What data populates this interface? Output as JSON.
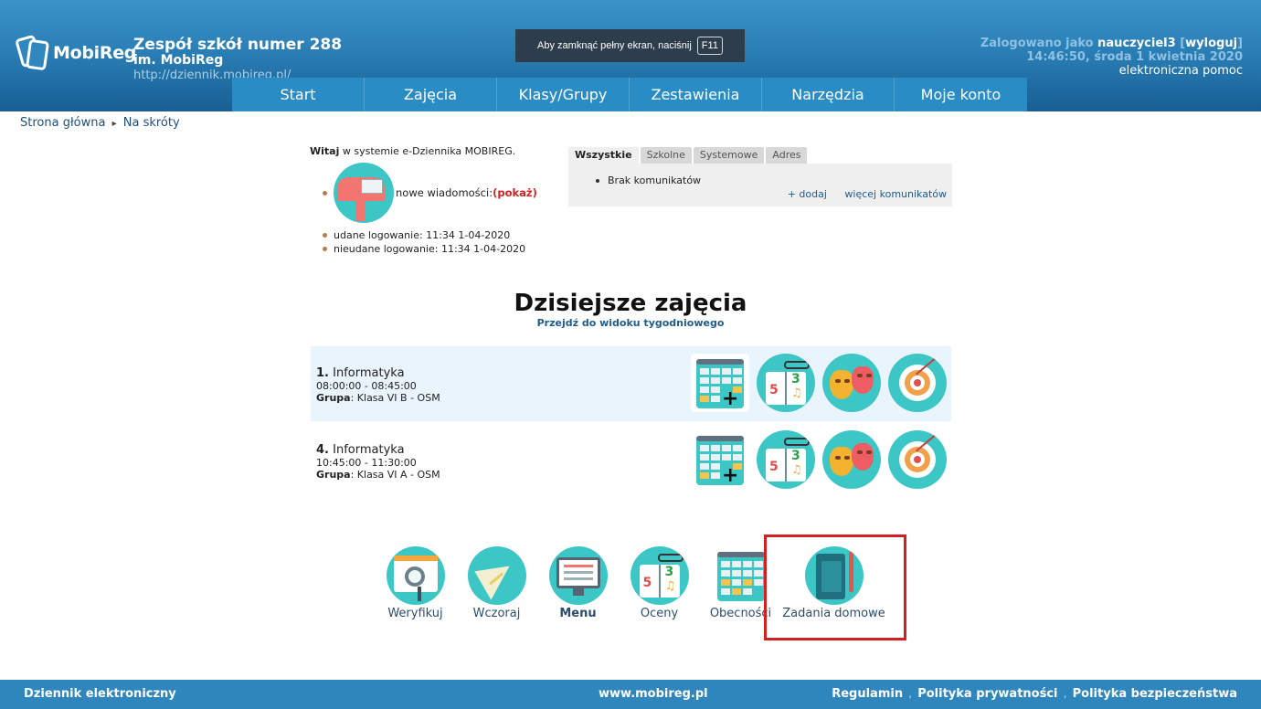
{
  "header": {
    "logo_text": "MobiReg",
    "school_name": "Zespół szkół numer 288",
    "school_sub": "im. MobiReg",
    "school_url": "http://dziennik.mobireg.pl/",
    "fullscreen_notice": "Aby zamknąć pełny ekran, naciśnij",
    "fullscreen_key": "F11",
    "login_prefix": "Zalogowano jako",
    "username": "nauczyciel3",
    "logout_open": "[",
    "logout_label": "wyloguj",
    "logout_close": "]",
    "datetime": "14:46:50, środa 1 kwietnia 2020",
    "help_label": "elektroniczna pomoc"
  },
  "nav": {
    "items": [
      "Start",
      "Zajęcia",
      "Klasy/Grupy",
      "Zestawienia",
      "Narzędzia",
      "Moje konto"
    ]
  },
  "breadcrumb": {
    "home": "Strona główna",
    "separator": "▸",
    "current": "Na skróty"
  },
  "welcome": {
    "bold": "Witaj",
    "rest": " w systemie e-Dziennika MOBIREG.",
    "new_messages": "nowe wiadomości: ",
    "show_open": "(",
    "show_label": "pokaż",
    "show_close": ")",
    "success_login": "udane logowanie: 11:34 1-04-2020",
    "failed_login": "nieudane logowanie: 11:34 1-04-2020"
  },
  "notices": {
    "tabs": [
      "Wszystkie",
      "Szkolne",
      "Systemowe",
      "Adres"
    ],
    "active_tab": "Wszystkie",
    "item": "Brak komunikatów",
    "add_label": "+ dodaj",
    "more_label": "więcej komunikatów"
  },
  "today": {
    "title": "Dzisiejsze zajęcia",
    "week_link": "Przejdź do widoku tygodniowego",
    "lessons": [
      {
        "number": "1.",
        "subject": "Informatyka",
        "time": "08:00:00 - 08:45:00",
        "group_label": "Grupa",
        "group": ": Klasa VI B - OSM"
      },
      {
        "number": "4.",
        "subject": "Informatyka",
        "time": "10:45:00 - 11:30:00",
        "group_label": "Grupa",
        "group": ": Klasa VI A - OSM"
      }
    ]
  },
  "shortcuts": {
    "items": [
      {
        "label": "Weryfikuj"
      },
      {
        "label": "Wczoraj"
      },
      {
        "label": "Menu"
      },
      {
        "label": "Oceny"
      },
      {
        "label": "Obecności"
      },
      {
        "label": "Zadania domowe"
      }
    ]
  },
  "footer": {
    "left": "Dziennik elektroniczny",
    "middle": "www.mobireg.pl",
    "links": [
      "Regulamin",
      "Polityka prywatności",
      "Polityka bezpieczeństwa"
    ],
    "separator": ","
  },
  "colors": {
    "header_blue": "#2a7fb6",
    "icon_teal": "#3cc6c6",
    "highlight_red": "#d21f1f",
    "show_red": "#d82020",
    "footer_blue": "#2e86bd"
  }
}
